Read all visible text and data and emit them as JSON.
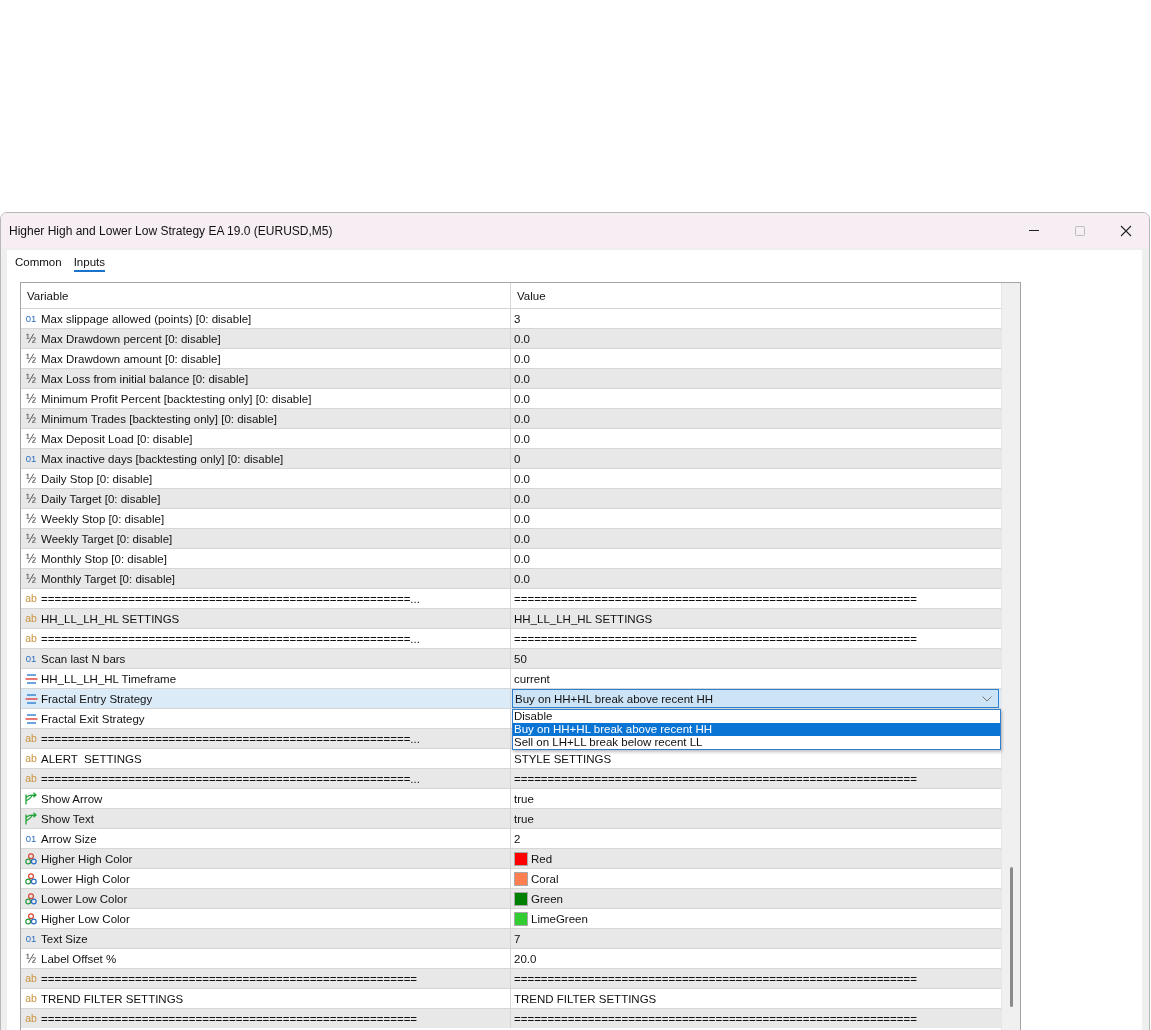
{
  "window": {
    "title": "Higher High and Lower Low Strategy EA 19.0 (EURUSD,M5)"
  },
  "tabs": [
    {
      "label": "Common",
      "selected": false
    },
    {
      "label": "Inputs",
      "selected": true
    }
  ],
  "table": {
    "columns": [
      "Variable",
      "Value"
    ],
    "rows": [
      {
        "kind": "int",
        "glyph": "01",
        "variable": "Max slippage allowed (points) [0: disable]",
        "value": "3",
        "selected": false
      },
      {
        "kind": "double",
        "glyph": "½",
        "variable": "Max Drawdown percent [0: disable]",
        "value": "0.0",
        "selected": false
      },
      {
        "kind": "double",
        "glyph": "½",
        "variable": "Max Drawdown amount [0: disable]",
        "value": "0.0",
        "selected": false
      },
      {
        "kind": "double",
        "glyph": "½",
        "variable": "Max Loss from initial balance [0: disable]",
        "value": "0.0",
        "selected": false
      },
      {
        "kind": "double",
        "glyph": "½",
        "variable": "Minimum Profit Percent [backtesting only] [0: disable]",
        "value": "0.0",
        "selected": false
      },
      {
        "kind": "double",
        "glyph": "½",
        "variable": "Minimum Trades [backtesting only] [0: disable]",
        "value": "0.0",
        "selected": false
      },
      {
        "kind": "double",
        "glyph": "½",
        "variable": "Max Deposit Load [0: disable]",
        "value": "0.0",
        "selected": false
      },
      {
        "kind": "int",
        "glyph": "01",
        "variable": "Max inactive days [backtesting only] [0: disable]",
        "value": "0",
        "selected": false
      },
      {
        "kind": "double",
        "glyph": "½",
        "variable": "Daily Stop [0: disable]",
        "value": "0.0",
        "selected": false
      },
      {
        "kind": "double",
        "glyph": "½",
        "variable": "Daily Target [0: disable]",
        "value": "0.0",
        "selected": false
      },
      {
        "kind": "double",
        "glyph": "½",
        "variable": "Weekly Stop [0: disable]",
        "value": "0.0",
        "selected": false
      },
      {
        "kind": "double",
        "glyph": "½",
        "variable": "Weekly Target [0: disable]",
        "value": "0.0",
        "selected": false
      },
      {
        "kind": "double",
        "glyph": "½",
        "variable": "Monthly Stop [0: disable]",
        "value": "0.0",
        "selected": false
      },
      {
        "kind": "double",
        "glyph": "½",
        "variable": "Monthly Target [0: disable]",
        "value": "0.0",
        "selected": false
      },
      {
        "kind": "string",
        "glyph": "ab",
        "variable": "=======================================================...",
        "value": "============================================================",
        "selected": false
      },
      {
        "kind": "string",
        "glyph": "ab",
        "variable": "HH_LL_LH_HL SETTINGS",
        "value": "HH_LL_LH_HL SETTINGS",
        "selected": false
      },
      {
        "kind": "string",
        "glyph": "ab",
        "variable": "=======================================================...",
        "value": "============================================================",
        "selected": false
      },
      {
        "kind": "int",
        "glyph": "01",
        "variable": "Scan last N bars",
        "value": "50",
        "selected": false
      },
      {
        "kind": "enum",
        "variable": "HH_LL_LH_HL Timeframe",
        "value": "current",
        "selected": false
      },
      {
        "kind": "enum",
        "variable": "Fractal Entry Strategy",
        "value": "Buy on HH+HL break above recent HH",
        "selected": true,
        "dropdown": {
          "options": [
            {
              "label": "Disable",
              "selected": false
            },
            {
              "label": "Buy on HH+HL break above recent HH",
              "selected": true
            },
            {
              "label": "Sell on LH+LL break below recent LL",
              "selected": false
            }
          ]
        }
      },
      {
        "kind": "enum",
        "variable": "Fractal Exit Strategy",
        "selected": false
      },
      {
        "kind": "string",
        "glyph": "ab",
        "variable": "=======================================================...",
        "selected": false
      },
      {
        "kind": "string",
        "glyph": "ab",
        "variable": "ALERT  SETTINGS",
        "value": "STYLE SETTINGS",
        "selected": false
      },
      {
        "kind": "string",
        "glyph": "ab",
        "variable": "=======================================================...",
        "value": "============================================================",
        "selected": false
      },
      {
        "kind": "bool",
        "variable": "Show Arrow",
        "value": "true",
        "selected": false
      },
      {
        "kind": "bool",
        "variable": "Show Text",
        "value": "true",
        "selected": false
      },
      {
        "kind": "int",
        "glyph": "01",
        "variable": "Arrow Size",
        "value": "2",
        "selected": false
      },
      {
        "kind": "color",
        "variable": "Higher High Color",
        "value": "Red",
        "color": "#ff0000",
        "selected": false
      },
      {
        "kind": "color",
        "variable": "Lower High Color",
        "value": "Coral",
        "color": "#ff7f50",
        "selected": false
      },
      {
        "kind": "color",
        "variable": "Lower Low Color",
        "value": "Green",
        "color": "#008000",
        "selected": false
      },
      {
        "kind": "color",
        "variable": "Higher Low Color",
        "value": "LimeGreen",
        "color": "#32cd32",
        "selected": false
      },
      {
        "kind": "int",
        "glyph": "01",
        "variable": "Text Size",
        "value": "7",
        "selected": false
      },
      {
        "kind": "double",
        "glyph": "½",
        "variable": "Label Offset %",
        "value": "20.0",
        "selected": false
      },
      {
        "kind": "string",
        "glyph": "ab",
        "variable": "========================================================",
        "value": "============================================================",
        "selected": false
      },
      {
        "kind": "string",
        "glyph": "ab",
        "variable": "TREND FILTER SETTINGS",
        "value": "TREND FILTER SETTINGS",
        "selected": false
      },
      {
        "kind": "string",
        "glyph": "ab",
        "variable": "========================================================",
        "value": "============================================================",
        "selected": false
      }
    ]
  }
}
